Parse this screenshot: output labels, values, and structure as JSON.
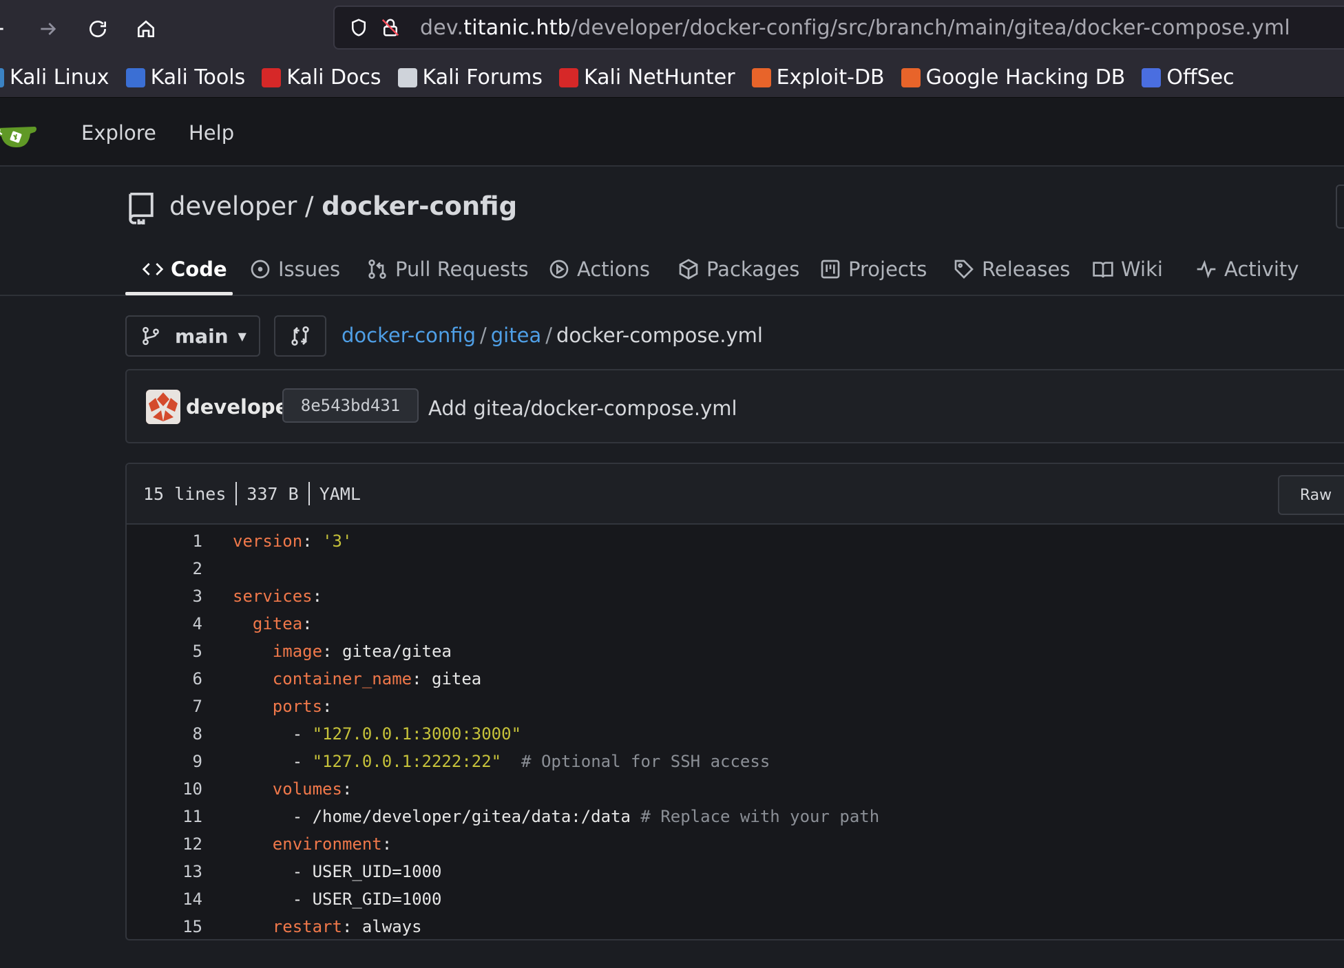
{
  "browser": {
    "url_prefix": "dev.",
    "url_host": "titanic.htb",
    "url_path": "/developer/docker-config/src/branch/main/gitea/docker-compose.yml"
  },
  "bookmarks": [
    {
      "label": "Kali Linux",
      "icon": "kali-dragon-icon",
      "color": "#3b83c4"
    },
    {
      "label": "Kali Tools",
      "icon": "kali-tools-icon",
      "color": "#3b6fd4"
    },
    {
      "label": "Kali Docs",
      "icon": "kali-docs-icon",
      "color": "#d62828"
    },
    {
      "label": "Kali Forums",
      "icon": "kali-forums-icon",
      "color": "#cfd3da"
    },
    {
      "label": "Kali NetHunter",
      "icon": "nethunter-icon",
      "color": "#d62828"
    },
    {
      "label": "Exploit-DB",
      "icon": "exploit-db-icon",
      "color": "#e8642a"
    },
    {
      "label": "Google Hacking DB",
      "icon": "ghdb-icon",
      "color": "#e8642a"
    },
    {
      "label": "OffSec",
      "icon": "offsec-icon",
      "color": "#4a6ee0"
    }
  ],
  "gitea_nav": {
    "explore": "Explore",
    "help": "Help"
  },
  "repo": {
    "owner": "developer",
    "separator": " / ",
    "name": "docker-config"
  },
  "tabs": [
    {
      "label": "Code",
      "icon": "code-icon",
      "active": true
    },
    {
      "label": "Issues",
      "icon": "issue-icon"
    },
    {
      "label": "Pull Requests",
      "icon": "pull-request-icon"
    },
    {
      "label": "Actions",
      "icon": "play-icon"
    },
    {
      "label": "Packages",
      "icon": "package-icon"
    },
    {
      "label": "Projects",
      "icon": "project-icon"
    },
    {
      "label": "Releases",
      "icon": "tag-icon"
    },
    {
      "label": "Wiki",
      "icon": "book-icon"
    },
    {
      "label": "Activity",
      "icon": "pulse-icon"
    }
  ],
  "branch": {
    "name": "main"
  },
  "breadcrumb": {
    "root": "docker-config",
    "dir": "gitea",
    "file": "docker-compose.yml",
    "sep": "/"
  },
  "commit": {
    "author": "developer",
    "sha": "8e543bd431",
    "message": "Add gitea/docker-compose.yml"
  },
  "file": {
    "lines": "15 lines",
    "size": "337 B",
    "language": "YAML",
    "raw_label": "Raw"
  },
  "code_lines": [
    [
      {
        "t": "version",
        "c": "k"
      },
      {
        "t": ": "
      },
      {
        "t": "'3'",
        "c": "s"
      }
    ],
    [],
    [
      {
        "t": "services",
        "c": "k"
      },
      {
        "t": ":"
      }
    ],
    [
      {
        "t": "  "
      },
      {
        "t": "gitea",
        "c": "k"
      },
      {
        "t": ":"
      }
    ],
    [
      {
        "t": "    "
      },
      {
        "t": "image",
        "c": "k"
      },
      {
        "t": ": gitea/gitea"
      }
    ],
    [
      {
        "t": "    "
      },
      {
        "t": "container_name",
        "c": "k"
      },
      {
        "t": ": gitea"
      }
    ],
    [
      {
        "t": "    "
      },
      {
        "t": "ports",
        "c": "k"
      },
      {
        "t": ":"
      }
    ],
    [
      {
        "t": "      - "
      },
      {
        "t": "\"127.0.0.1:3000:3000\"",
        "c": "s"
      }
    ],
    [
      {
        "t": "      - "
      },
      {
        "t": "\"127.0.0.1:2222:22\"",
        "c": "s"
      },
      {
        "t": "  "
      },
      {
        "t": "# Optional for SSH access",
        "c": "c"
      }
    ],
    [
      {
        "t": "    "
      },
      {
        "t": "volumes",
        "c": "k"
      },
      {
        "t": ":"
      }
    ],
    [
      {
        "t": "      - /home/developer/gitea/data:/data "
      },
      {
        "t": "# Replace with your path",
        "c": "c"
      }
    ],
    [
      {
        "t": "    "
      },
      {
        "t": "environment",
        "c": "k"
      },
      {
        "t": ":"
      }
    ],
    [
      {
        "t": "      - USER_UID=1000"
      }
    ],
    [
      {
        "t": "      - USER_GID=1000"
      }
    ],
    [
      {
        "t": "    "
      },
      {
        "t": "restart",
        "c": "k"
      },
      {
        "t": ": always"
      }
    ]
  ]
}
